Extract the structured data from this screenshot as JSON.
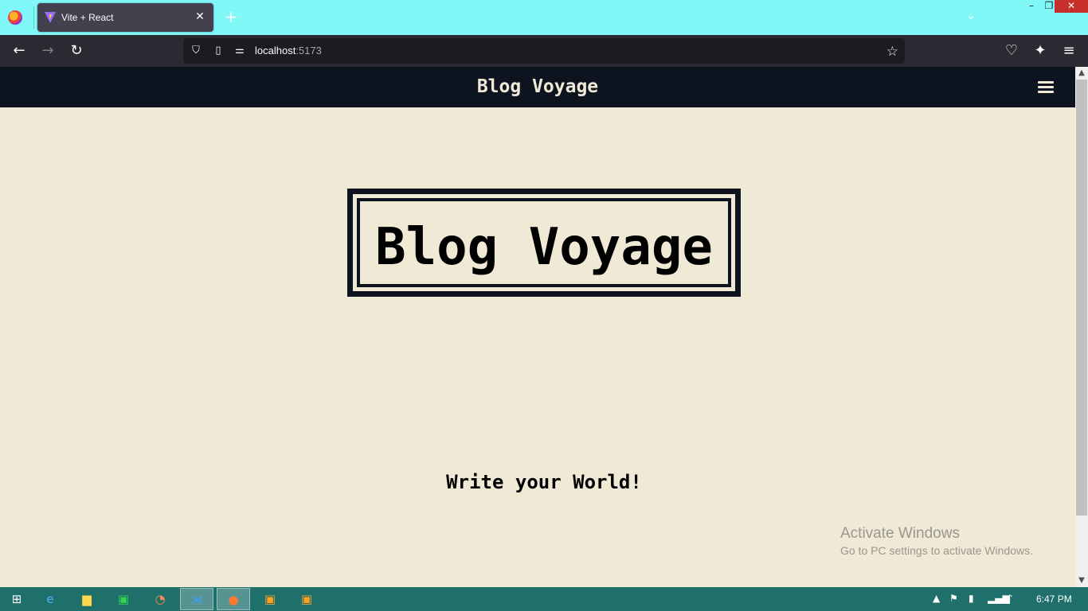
{
  "browser": {
    "tab_title": "Vite + React",
    "tab_close": "✕",
    "new_tab": "+",
    "url_host": "localhost",
    "url_port": ":5173",
    "window_buttons": {
      "minimize": "–",
      "maximize": "❐",
      "close": "✕"
    }
  },
  "site": {
    "header_title": "Blog Voyage",
    "hero_title": "Blog Voyage",
    "tagline": "Write your World!"
  },
  "watermark": {
    "title": "Activate Windows",
    "subtitle": "Go to PC settings to activate Windows."
  },
  "taskbar": {
    "clock": "6:47 PM"
  },
  "colors": {
    "page_bg": "#f0e9d6",
    "header_bg": "#0e1320",
    "tabstrip_bg": "#80f8f8",
    "taskbar_bg": "#1f6f6b"
  }
}
